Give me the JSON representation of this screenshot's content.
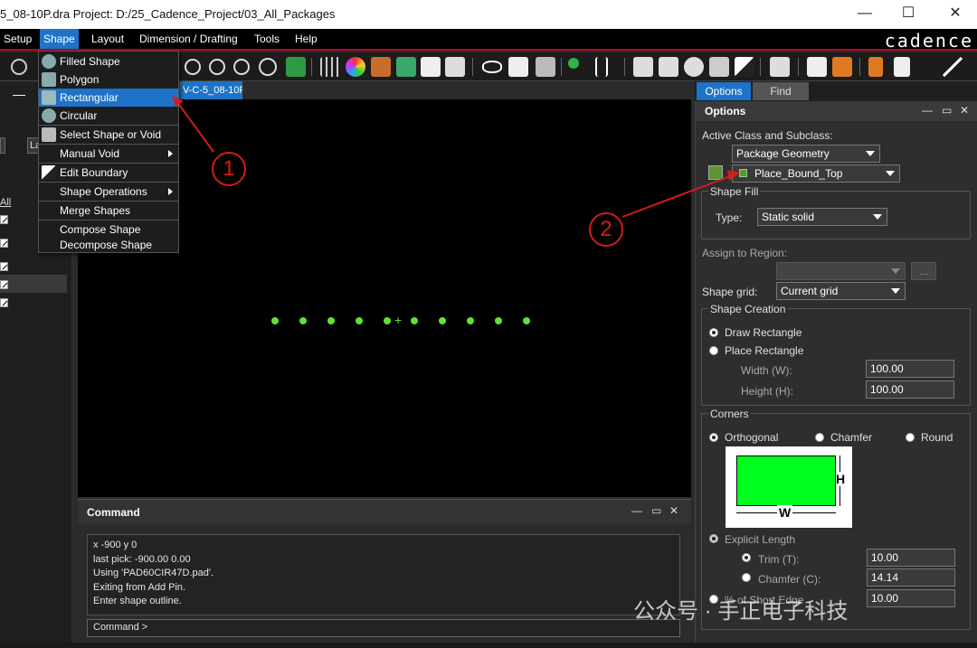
{
  "window": {
    "title": "5_08-10P.dra  Project: D:/25_Cadence_Project/03_All_Packages",
    "minimize": "—",
    "maximize": "☐",
    "close": "✕"
  },
  "menubar": {
    "items": [
      "Setup",
      "Shape",
      "Layout",
      "Dimension / Drafting",
      "Tools",
      "Help"
    ],
    "active": "Shape",
    "brand": "cadence"
  },
  "toolbar": {
    "icons": [
      "undo-icon",
      "zoom-in-icon",
      "zoom-fit-icon",
      "zoom-prev-icon",
      "redraw-icon",
      "layers-icon",
      "grid-icon",
      "color-icon",
      "shade-icon",
      "stack-icon",
      "report-icon",
      "settings-icon",
      "visibility-icon",
      "info-icon",
      "3d-icon",
      "pin-icon",
      "text-icon",
      "add-shape-icon",
      "route-icon",
      "via-icon",
      "void-icon",
      "fill-icon",
      "camera-icon",
      "export-icon",
      "swap-icon",
      "connect-icon",
      "hand-icon",
      "pencil-icon"
    ]
  },
  "canvas": {
    "tab_label": "V-C-5_08-10P",
    "pad_count": 10,
    "pad_color": "#5ee332"
  },
  "left_panel": {
    "items": [
      "La",
      "All"
    ]
  },
  "shape_menu": {
    "items": [
      {
        "label": "Filled Shape",
        "icon": "filled-shape-icon",
        "submenu": false
      },
      {
        "label": "Polygon",
        "icon": "polygon-icon",
        "submenu": false
      },
      {
        "label": "Rectangular",
        "icon": "rectangular-icon",
        "submenu": false,
        "highlighted": true
      },
      {
        "label": "Circular",
        "icon": "circular-icon",
        "submenu": false
      },
      {
        "label": "Select Shape or Void",
        "icon": "select-shape-icon",
        "submenu": false
      },
      {
        "label": "Manual Void",
        "icon": "",
        "submenu": true
      },
      {
        "label": "Edit Boundary",
        "icon": "edit-boundary-icon",
        "submenu": false
      },
      {
        "label": "Shape Operations",
        "icon": "",
        "submenu": true
      },
      {
        "label": "Merge Shapes",
        "icon": "",
        "submenu": false
      },
      {
        "label": "Compose Shape",
        "icon": "",
        "submenu": false
      },
      {
        "label": "Decompose Shape",
        "icon": "",
        "submenu": false
      }
    ]
  },
  "command": {
    "title": "Command",
    "log": [
      "x -900 y 0",
      "last pick:  -900.00 0.00",
      "Using 'PAD60CIR47D.pad'.",
      "Exiting from Add Pin.",
      "Enter shape outline."
    ],
    "prompt": "Command >"
  },
  "right_panel": {
    "tabs": [
      "Options",
      "Find"
    ],
    "title": "Options",
    "active_class_label": "Active Class and Subclass:",
    "class_value": "Package Geometry",
    "subclass_value": "Place_Bound_Top",
    "shape_fill_label": "Shape Fill",
    "type_label": "Type:",
    "type_value": "Static solid",
    "assign_region_label": "Assign to Region:",
    "assign_region_value": "",
    "browse_label": "...",
    "shape_grid_label": "Shape grid:",
    "shape_grid_value": "Current grid",
    "shape_creation_label": "Shape Creation",
    "draw_rect_label": "Draw Rectangle",
    "place_rect_label": "Place Rectangle",
    "width_label": "Width (W):",
    "width_value": "100.00",
    "height_label": "Height (H):",
    "height_value": "100.00",
    "corners_label": "Corners",
    "orthogonal_label": "Orthogonal",
    "chamfer_label": "Chamfer",
    "round_label": "Round",
    "diagram_w": "W",
    "diagram_h": "H",
    "explicit_length_label": "Explicit Length",
    "trim_label": "Trim (T):",
    "trim_value": "10.00",
    "chamfer_c_label": "Chamfer (C):",
    "chamfer_c_value": "14.14",
    "short_edge_label": "% of Short Edge",
    "short_edge_value": "10.00",
    "swatch_color": "#5a9632"
  },
  "annotations": {
    "callout_1": "1",
    "callout_2": "2"
  },
  "watermark": "公众号 · 手正电子科技"
}
